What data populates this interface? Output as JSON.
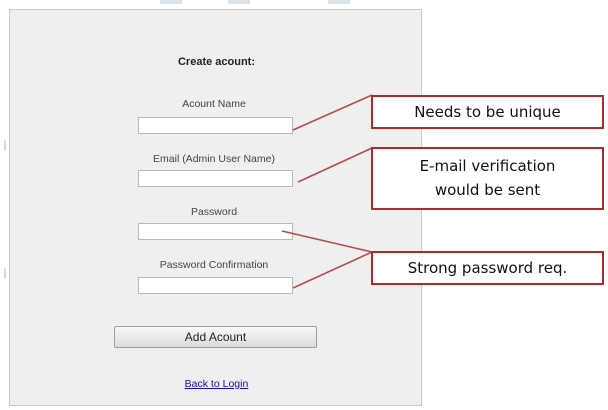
{
  "form": {
    "title": "Create acount:",
    "fields": [
      {
        "label": "Acount Name",
        "value": "",
        "placeholder": ""
      },
      {
        "label": "Email (Admin User Name)",
        "value": "",
        "placeholder": ""
      },
      {
        "label": "Password",
        "value": "",
        "placeholder": ""
      },
      {
        "label": "Password Confirmation",
        "value": "",
        "placeholder": ""
      }
    ],
    "submit_label": "Add Acount",
    "back_link": "Back to Login"
  },
  "annotations": [
    {
      "text": "Needs to be unique"
    },
    {
      "line1": "E-mail verification",
      "line2": "would be sent"
    },
    {
      "text": "Strong password req."
    }
  ],
  "colors": {
    "panel_bg": "#efefef",
    "callout_border": "#b12a2a",
    "leader_line": "#b84a4a",
    "link": "#1a0dab"
  }
}
